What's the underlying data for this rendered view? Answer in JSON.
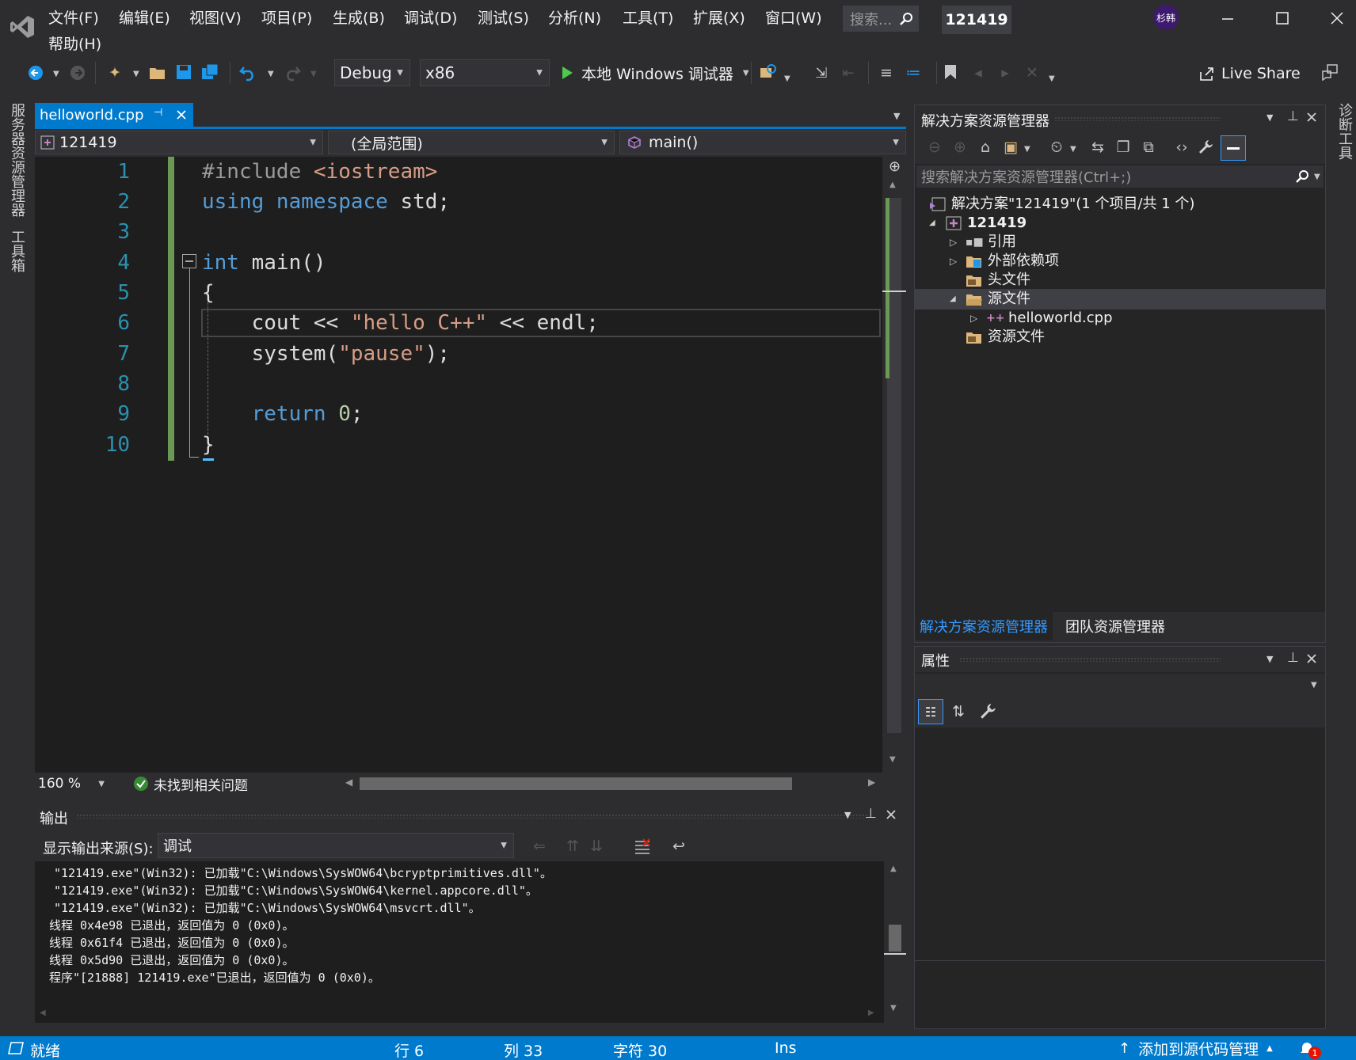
{
  "title_bar": {
    "menus": [
      "文件(F)",
      "编辑(E)",
      "视图(V)",
      "项目(P)",
      "生成(B)",
      "调试(D)",
      "测试(S)",
      "分析(N)",
      "工具(T)",
      "扩展(X)",
      "窗口(W)",
      "帮助(H)"
    ],
    "search_placeholder": "搜索...",
    "project_name": "121419",
    "user_initials": "杉韩"
  },
  "toolbar": {
    "config": "Debug",
    "platform": "x86",
    "run_label": "本地 Windows 调试器",
    "live_share": "Live Share"
  },
  "left_side_tabs": [
    "服务器资源管理器",
    "工具箱"
  ],
  "right_side_tabs": [
    "诊断工具"
  ],
  "editor": {
    "tab_label": "helloworld.cpp",
    "nav_project": "121419",
    "nav_scope": "(全局范围)",
    "nav_member": "main()",
    "line_numbers": [
      "1",
      "2",
      "3",
      "4",
      "5",
      "6",
      "7",
      "8",
      "9",
      "10"
    ],
    "zoom": "160 %",
    "issues": "未找到相关问题",
    "code": {
      "l1_a": "#include ",
      "l1_b": "<iostream>",
      "l2_a": "using",
      "l2_b": " namespace",
      "l2_c": " std;",
      "l4_a": "int",
      "l4_b": " main()",
      "l5": "{",
      "l6_a": "    cout << ",
      "l6_b": "\"hello C++\"",
      "l6_c": " << endl;",
      "l7_a": "    system(",
      "l7_b": "\"pause\"",
      "l7_c": ");",
      "l9_a": "    return",
      "l9_b": " 0",
      "l9_c": ";",
      "l10": "}"
    }
  },
  "solution_explorer": {
    "title": "解决方案资源管理器",
    "search_placeholder": "搜索解决方案资源管理器(Ctrl+;)",
    "solution": "解决方案\"121419\"(1 个项目/共 1 个)",
    "project": "121419",
    "references": "引用",
    "external_deps": "外部依赖项",
    "headers": "头文件",
    "sources": "源文件",
    "source_file": "helloworld.cpp",
    "resources": "资源文件",
    "tab_solution": "解决方案资源管理器",
    "tab_team": "团队资源管理器"
  },
  "properties": {
    "title": "属性"
  },
  "output": {
    "title": "输出",
    "source_label": "显示输出来源(S):",
    "source_value": "调试",
    "lines": [
      "\"121419.exe\"(Win32): 已加载\"C:\\Windows\\SysWOW64\\bcryptprimitives.dll\"。",
      "\"121419.exe\"(Win32): 已加载\"C:\\Windows\\SysWOW64\\kernel.appcore.dll\"。",
      "\"121419.exe\"(Win32): 已加载\"C:\\Windows\\SysWOW64\\msvcrt.dll\"。",
      "线程 0x4e98 已退出，返回值为 0 (0x0)。",
      "线程 0x61f4 已退出，返回值为 0 (0x0)。",
      "线程 0x5d90 已退出，返回值为 0 (0x0)。",
      "程序\"[21888] 121419.exe\"已退出，返回值为 0 (0x0)。"
    ]
  },
  "status_bar": {
    "ready": "就绪",
    "line": "行 6",
    "col": "列 33",
    "char": "字符 30",
    "mode": "Ins",
    "source_control": "添加到源代码管理",
    "notification_count": "1"
  },
  "colors": {
    "accent": "#007acc",
    "background": "#2d2d30",
    "editor_bg": "#1e1e1e",
    "change_bar": "#6a9955"
  }
}
